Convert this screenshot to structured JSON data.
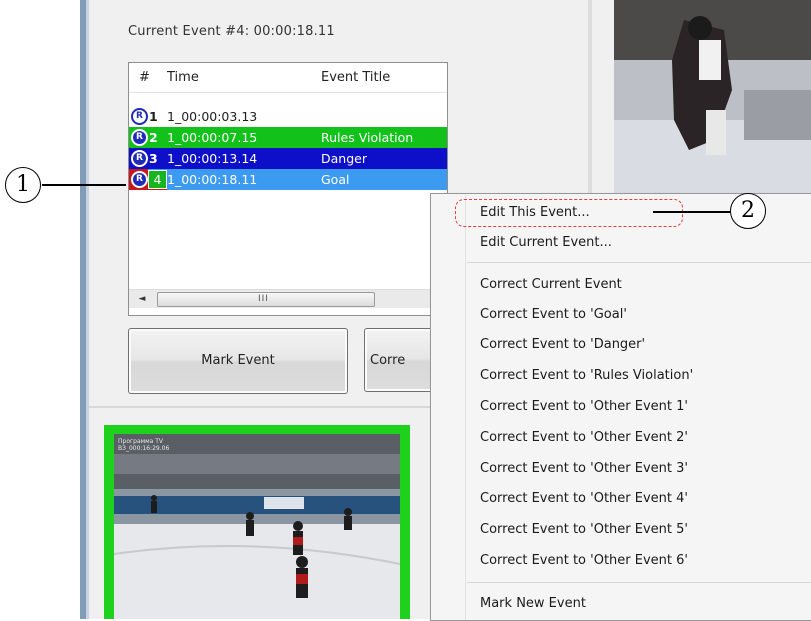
{
  "current_event_label": "Current Event #4: 00:00:18.11",
  "event_list": {
    "columns": [
      "#",
      "Time",
      "Event Title"
    ],
    "rows": [
      {
        "icon": "R",
        "num": "1",
        "time": "1_00:00:03.13",
        "title": ""
      },
      {
        "icon": "R",
        "num": "2",
        "time": "1_00:00:07.15",
        "title": "Rules Violation"
      },
      {
        "icon": "R",
        "num": "3",
        "time": "1_00:00:13.14",
        "title": "Danger"
      },
      {
        "icon": "R",
        "num": "4",
        "time": "1_00:00:18.11",
        "title": "Goal"
      }
    ],
    "scroll_left_glyph": "◄",
    "scroll_grip": "III"
  },
  "buttons": {
    "mark_event": "Mark Event",
    "correct": "Corre"
  },
  "video_overlay": {
    "line1": "Программа TV",
    "line2": "ВЗ_000:16:29.06"
  },
  "context_menu": {
    "items": [
      "Edit This Event...",
      "Edit Current Event...",
      "Correct Current Event",
      "Correct Event to 'Goal'",
      "Correct Event to 'Danger'",
      "Correct Event to 'Rules Violation'",
      "Correct Event to 'Other Event 1'",
      "Correct Event to 'Other Event 2'",
      "Correct Event to 'Other Event 3'",
      "Correct Event to 'Other Event 4'",
      "Correct Event to 'Other Event 5'",
      "Correct Event to 'Other Event 6'",
      "Mark New Event"
    ]
  },
  "callouts": {
    "one": "1",
    "two": "2"
  },
  "colors": {
    "violation_row": "#12c21a",
    "danger_row": "#0e10c9",
    "goal_row_selected": "#3c9bf1",
    "highlight_dash": "#e53b3b",
    "video_border": "#1dd11d"
  }
}
